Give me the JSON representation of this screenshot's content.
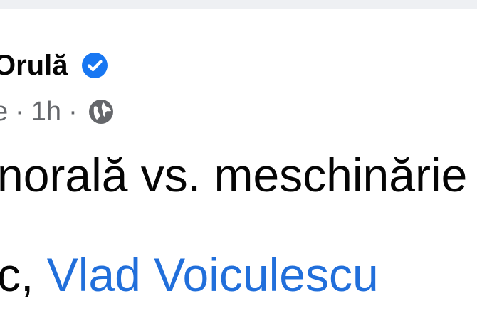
{
  "post": {
    "author": {
      "name": "Orulă",
      "verified_icon": "verified-badge-icon",
      "verified_color": "#1877f2"
    },
    "meta": {
      "audience_suffix": "e",
      "separator": "·",
      "time": "1h",
      "privacy_icon": "globe-icon"
    },
    "body": {
      "line1": "norală vs. meschinărie",
      "line2_prefix": "c,",
      "mention": "Vlad Voiculescu"
    }
  },
  "colors": {
    "text": "#050505",
    "meta_text": "#65676b",
    "mention": "#216fdb",
    "top_strip": "#eef0f3"
  }
}
